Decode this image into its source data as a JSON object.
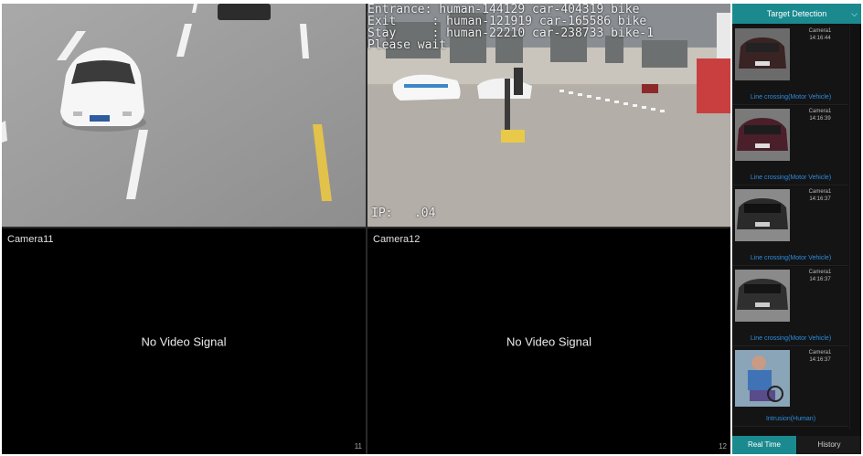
{
  "tiles": {
    "cam11_label": "Camera11",
    "cam12_label": "Camera12",
    "no_signal": "No Video Signal",
    "cam11_num": "11",
    "cam12_num": "12"
  },
  "osd": {
    "line1": "Entrance: human-144129 car-404319 bike",
    "line2": "Exit     : human-121919 car-165586 bike",
    "line3": "Stay     : human-22210 car-238733 bike-1",
    "line4": "Please wait",
    "ip": "IP:   .04"
  },
  "panel": {
    "title": "Target Detection",
    "items": [
      {
        "camera": "Camera1",
        "time": "14:16:44",
        "event": "Line crossing(Motor Vehicle)",
        "icon": "vehicle-thumb"
      },
      {
        "camera": "Camera1",
        "time": "14:16:39",
        "event": "Line crossing(Motor Vehicle)",
        "icon": "vehicle-thumb"
      },
      {
        "camera": "Camera1",
        "time": "14:16:37",
        "event": "Line crossing(Motor Vehicle)",
        "icon": "vehicle-thumb"
      },
      {
        "camera": "Camera1",
        "time": "14:16:37",
        "event": "Line crossing(Motor Vehicle)",
        "icon": "vehicle-thumb"
      },
      {
        "camera": "Camera1",
        "time": "14:16:37",
        "event": "Intrusion(Human)",
        "icon": "human-thumb"
      }
    ],
    "tabs": [
      "Real Time",
      "History"
    ]
  }
}
